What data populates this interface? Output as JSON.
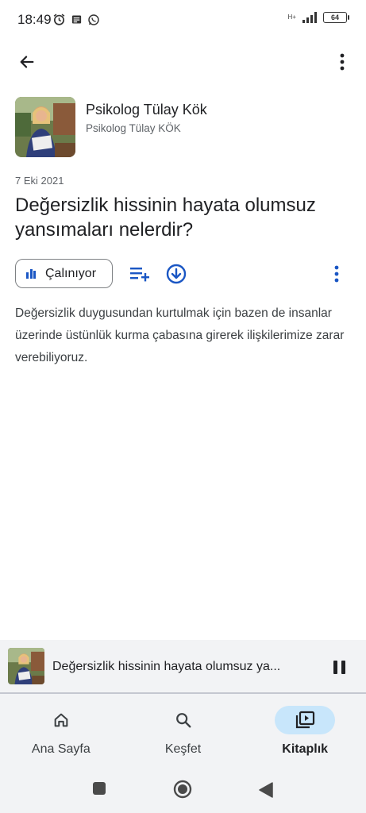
{
  "status_bar": {
    "time": "18:49",
    "network_label": "H+",
    "battery": "64"
  },
  "podcast": {
    "title": "Psikolog Tülay Kök",
    "author": "Psikolog Tülay KÖK"
  },
  "episode": {
    "date": "7 Eki 2021",
    "title": "Değersizlik hissinin hayata olumsuz yansımaları nelerdir?",
    "playing_label": "Çalınıyor",
    "description": "Değersizlik duygusundan kurtulmak için bazen de insanlar üzerinde üstünlük kurma çabasına girerek ilişkilerimize zarar verebiliyoruz."
  },
  "mini_player": {
    "title": "Değersizlik hissinin hayata olumsuz ya..."
  },
  "nav": {
    "items": [
      {
        "label": "Ana Sayfa",
        "icon": "home-icon"
      },
      {
        "label": "Keşfet",
        "icon": "search-icon"
      },
      {
        "label": "Kitaplık",
        "icon": "library-icon",
        "active": true
      }
    ]
  },
  "colors": {
    "accent": "#1a56c4",
    "active_nav_bg": "#c8e6fb",
    "surface": "#f2f3f5"
  }
}
